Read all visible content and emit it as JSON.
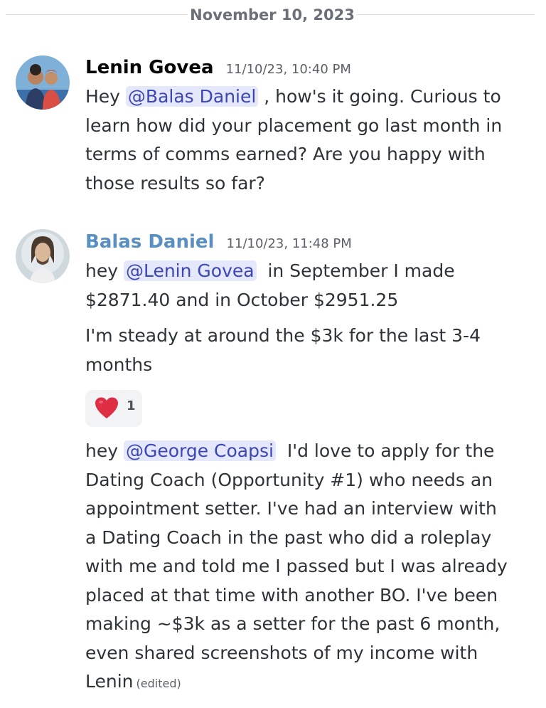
{
  "date_divider": "November 10, 2023",
  "messages": {
    "lenin": {
      "author": "Lenin Govea",
      "author_color": "#060607",
      "timestamp": "11/10/23, 10:40 PM",
      "part1": "Hey ",
      "mention": "@Balas Daniel",
      "part2": " , how's it going. Curious to",
      "line2": "learn how did your placement go last month in",
      "line3": "terms of comms earned? Are you happy with",
      "line4": "those results so far?"
    },
    "balas": {
      "author": "Balas Daniel",
      "author_color": "#5a8fc2",
      "timestamp": "11/10/23, 11:48 PM",
      "msg1_part1": "hey ",
      "msg1_mention": "@Lenin Govea",
      "msg1_part2": "  in September I made",
      "msg1_line2": "$2871.40 and in October $2951.25",
      "msg2_line1": "I'm steady at around the $3k for the last 3-4",
      "msg2_line2": "months",
      "reaction": {
        "emoji": "heart-emoji",
        "count": "1"
      },
      "msg3_part1": "hey ",
      "msg3_mention": "@George Coapsi",
      "msg3_part2": "  I'd love to apply for the",
      "msg3_line2": "Dating Coach (Opportunity #1) who needs an",
      "msg3_line3": "appointment setter. I've had an interview with",
      "msg3_line4": "a Dating Coach in the past who did a roleplay",
      "msg3_line5": "with me and told me I passed but I was already",
      "msg3_line6": "placed at that time with another BO. I've been",
      "msg3_line7": "making ~$3k as a setter for the past 6 month,",
      "msg3_line8": "even shared screenshots of my income with",
      "msg3_line9": "Lenin",
      "edited_label": "(edited)"
    }
  }
}
